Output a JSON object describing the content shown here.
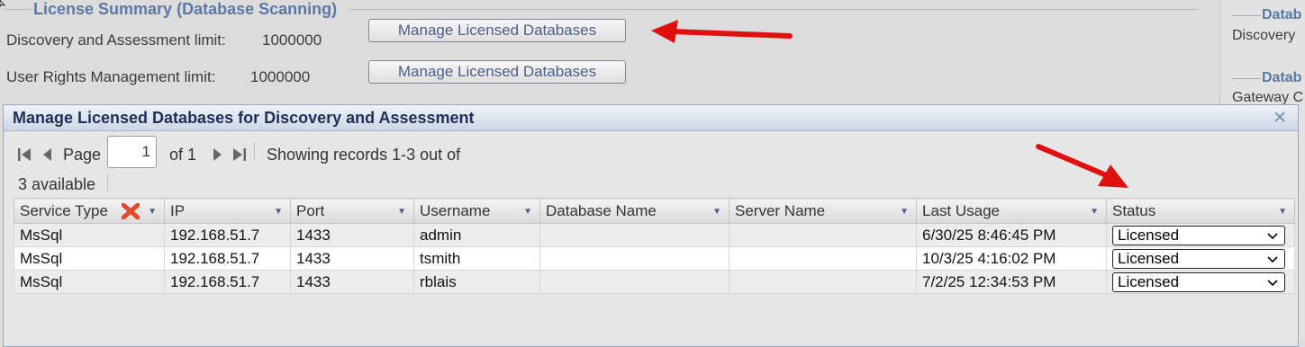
{
  "license_summary": {
    "legend": "License Summary (Database Scanning)",
    "rows": [
      {
        "label": "Discovery and Assessment limit:",
        "value": "1000000",
        "button": "Manage Licensed Databases"
      },
      {
        "label": "User Rights Management limit:",
        "value": "1000000",
        "button": "Manage Licensed Databases"
      }
    ]
  },
  "right_panel": {
    "section1_legend": "Datab",
    "section1_text": "Discovery",
    "section2_legend": "Datab",
    "section2_text": "Gateway C"
  },
  "dialog": {
    "title": "Manage Licensed Databases for Discovery and Assessment",
    "close_glyph": "✕",
    "pager": {
      "page_label": "Page",
      "page_value": "1",
      "of_label": "of 1",
      "showing_line1": "Showing records 1-3 out of",
      "showing_line2": "3 available"
    },
    "columns": [
      "Service Type",
      "IP",
      "Port",
      "Username",
      "Database Name",
      "Server Name",
      "Last Usage",
      "Status"
    ],
    "rows": [
      {
        "service": "MsSql",
        "ip": "192.168.51.7",
        "port": "1433",
        "username": "admin",
        "database": "",
        "server": "",
        "last_usage": "6/30/25 8:46:45 PM",
        "status": "Licensed"
      },
      {
        "service": "MsSql",
        "ip": "192.168.51.7",
        "port": "1433",
        "username": "tsmith",
        "database": "",
        "server": "",
        "last_usage": "10/3/25 4:16:02 PM",
        "status": "Licensed"
      },
      {
        "service": "MsSql",
        "ip": "192.168.51.7",
        "port": "1433",
        "username": "rblais",
        "database": "",
        "server": "",
        "last_usage": "7/2/25 12:34:53 PM",
        "status": "Licensed"
      }
    ]
  },
  "colors": {
    "accent": "#5b79a6",
    "title_text": "#1f2f5a",
    "annotation_arrow": "#e01010",
    "remove_icon": "#e04a2a"
  },
  "icons": [
    "first-page-icon",
    "prev-page-icon",
    "next-page-icon",
    "last-page-icon",
    "remove-filter-icon",
    "sort-down-icon",
    "close-icon",
    "chevron-down-icon",
    "annotation-arrow"
  ]
}
